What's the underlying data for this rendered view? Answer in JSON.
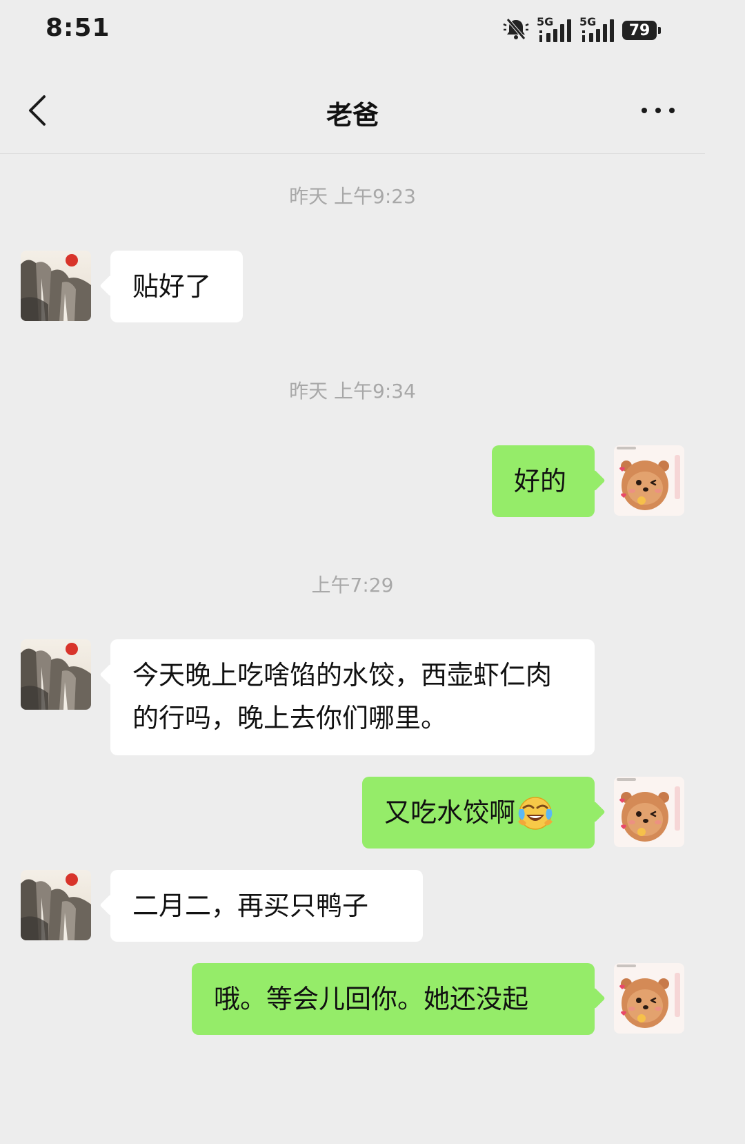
{
  "status_bar": {
    "time": "8:51",
    "network_1": "5G",
    "network_2": "5G",
    "battery_level": "79"
  },
  "nav": {
    "title": "老爸"
  },
  "messages": [
    {
      "type": "timestamp",
      "text": "昨天 上午9:23"
    },
    {
      "type": "received",
      "text": "贴好了"
    },
    {
      "type": "timestamp",
      "text": "昨天 上午9:34"
    },
    {
      "type": "sent",
      "text": "好的"
    },
    {
      "type": "timestamp",
      "text": "上午7:29"
    },
    {
      "type": "received",
      "text": "今天晚上吃啥馅的水饺，西壶虾仁肉的行吗，晚上去你们哪里。"
    },
    {
      "type": "sent",
      "text": "又吃水饺啊",
      "emoji": "crying-laughing-emoji"
    },
    {
      "type": "received",
      "text": "二月二，再买只鸭子"
    },
    {
      "type": "sent",
      "text": "哦。等会儿回你。她还没起"
    }
  ],
  "colors": {
    "background": "#ededed",
    "sent_bubble": "#95ec69",
    "received_bubble": "#ffffff",
    "timestamp_text": "#a8a8a8"
  }
}
